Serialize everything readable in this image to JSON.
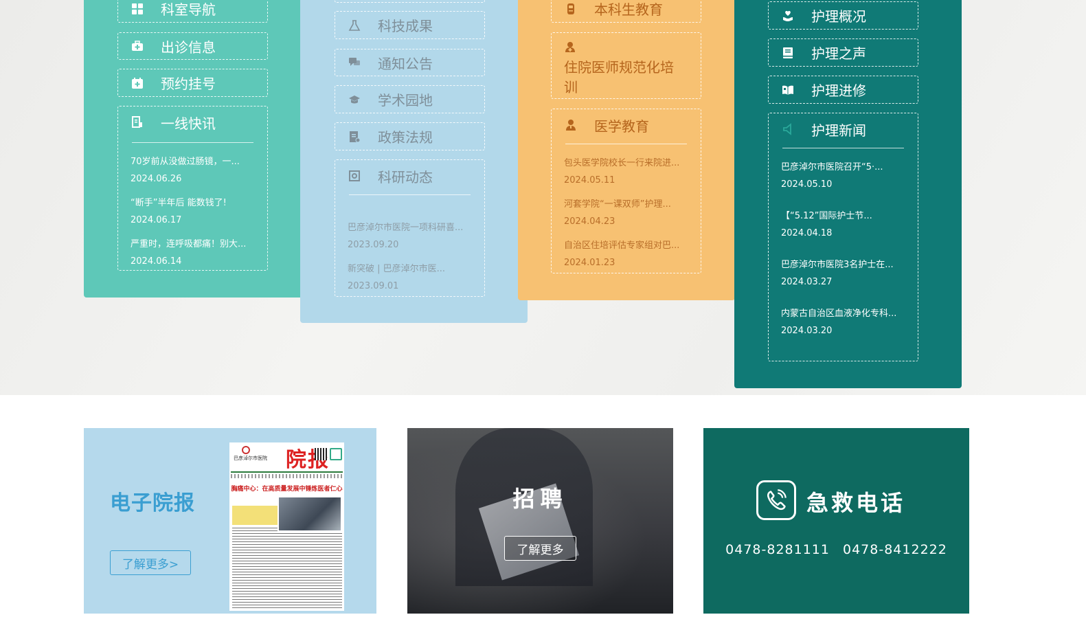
{
  "col1": {
    "buttons": [
      {
        "label": "科室导航",
        "icon": "grid-icon"
      },
      {
        "label": "出诊信息",
        "icon": "medical-kit-icon"
      },
      {
        "label": "预约挂号",
        "icon": "calendar-icon"
      }
    ],
    "panel": {
      "title": "一线快讯",
      "news": [
        {
          "title": "70岁前从没做过肠镜，一...",
          "date": "2024.06.26"
        },
        {
          "title": "“断手”半年后 能数钱了!",
          "date": "2024.06.17"
        },
        {
          "title": "严重时，连呼吸都痛！别大...",
          "date": "2024.06.14"
        }
      ]
    }
  },
  "col2": {
    "buttons": [
      {
        "label": "科技成果",
        "icon": "flask-icon"
      },
      {
        "label": "通知公告",
        "icon": "chat-icon"
      },
      {
        "label": "学术园地",
        "icon": "graduation-cap-icon"
      },
      {
        "label": "政策法规",
        "icon": "document-icon"
      }
    ],
    "panel": {
      "title": "科研动态",
      "news": [
        {
          "title": "巴彦淖尔市医院一项科研喜...",
          "date": "2023.09.20"
        },
        {
          "title": "新突破 | 巴彦淖尔市医...",
          "date": "2023.09.01"
        }
      ]
    }
  },
  "col3": {
    "buttons": [
      {
        "label": "本科生教育",
        "icon": "student-icon"
      },
      {
        "label": "住院医师规范化培训",
        "icon": "doctor-icon"
      }
    ],
    "panel": {
      "title": "医学教育",
      "news": [
        {
          "title": "包头医学院校长一行来院进...",
          "date": "2024.05.11"
        },
        {
          "title": "河套学院“一课双师”护理...",
          "date": "2024.04.23"
        },
        {
          "title": "自治区住培评估专家组对巴...",
          "date": "2024.01.23"
        }
      ]
    }
  },
  "col4": {
    "buttons": [
      {
        "label": "护理概况",
        "icon": "hand-heart-icon"
      },
      {
        "label": "护理之声",
        "icon": "book-icon"
      },
      {
        "label": "护理进修",
        "icon": "open-book-icon"
      }
    ],
    "panel": {
      "title": "护理新闻",
      "news": [
        {
          "title": "巴彦淖尔市医院召开“5·...",
          "date": "2024.05.10"
        },
        {
          "title": "【“5.12”国际护士节...",
          "date": "2024.04.18"
        },
        {
          "title": "巴彦淖尔市医院3名护士在...",
          "date": "2024.03.27"
        },
        {
          "title": "内蒙古自治区血液净化专科...",
          "date": "2024.03.20"
        }
      ]
    }
  },
  "paper_card": {
    "title": "电子院报",
    "button": "了解更多>",
    "thumb": {
      "masthead": "院报",
      "logo_text": "巴彦淖尔市医院",
      "headline": "胸痛中心：在高质量发展中锤炼医者仁心"
    }
  },
  "recruit_card": {
    "title": "招聘",
    "button": "了解更多"
  },
  "emergency_card": {
    "title": "急救电话",
    "phones": "0478-8281111   0478-8412222",
    "icon": "phone-icon"
  },
  "colors": {
    "teal": "#5ec8b8",
    "light_blue": "#b2d8ea",
    "orange": "#f7c172",
    "dark_teal": "#107a76",
    "paper_accent": "#3a9ed1",
    "emergency_green": "#0e6a60"
  }
}
